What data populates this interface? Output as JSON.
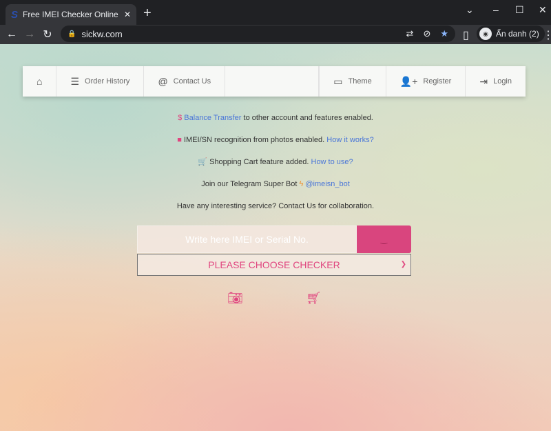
{
  "browser": {
    "tab_title": "Free IMEI Checker Online - SICKW",
    "url": "sickw.com",
    "profile": "Ẩn danh (2)"
  },
  "nav": {
    "order_history": "Order History",
    "contact_us": "Contact Us",
    "theme": "Theme",
    "register": "Register",
    "login": "Login"
  },
  "news": {
    "l1_link": "Balance Transfer",
    "l1_text": " to other account and features enabled.",
    "l2_text": " IMEI/SN recognition from photos enabled. ",
    "l2_link": "How it works?",
    "l3_text": " Shopping Cart feature added. ",
    "l3_link": "How to use?",
    "l4_text": "Join our Telegram Super Bot ",
    "l4_link": "@imeisn_bot",
    "l5_text": "Have any interesting service? Contact Us for collaboration."
  },
  "form": {
    "imei_placeholder": "Write here IMEI or Serial No.",
    "imei_value": "",
    "submit": "‿",
    "checker_selected": "PLEASE CHOOSE CHECKER"
  },
  "colors": {
    "accent": "#e0457f",
    "link": "#4a76d8"
  }
}
